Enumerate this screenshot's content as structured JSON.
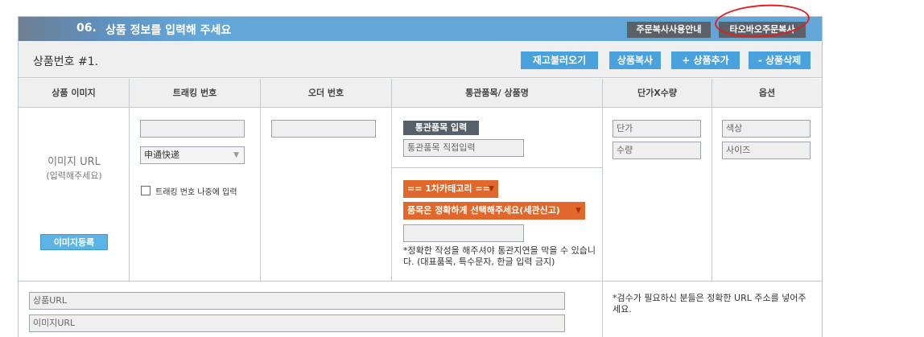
{
  "header": {
    "number": "06.",
    "title": "상품 정보를 입력해 주세요",
    "guide_button": "주문복사사용안내",
    "copy_button": "타오바오주문복사"
  },
  "product": {
    "label": "상품번호 #1.",
    "buttons": {
      "load_stock": "재고불러오기",
      "duplicate": "상품복사",
      "add": "+ 상품추가",
      "delete": "- 상품삭제"
    }
  },
  "columns": [
    "상품 이미지",
    "트래킹 번호",
    "오더 번호",
    "통관품목/ 상품명",
    "단가X수량",
    "옵션"
  ],
  "image": {
    "url_label": "이미지 URL",
    "url_sub": "(입력해주세요)",
    "register_button": "이미지등록"
  },
  "tracking": {
    "input_value": "",
    "carrier_select": "申通快递",
    "later_checkbox_label": "트래킹 번호 나중에 입력"
  },
  "order": {
    "input_value": ""
  },
  "customs": {
    "tag": "통관품목 입력",
    "direct_input_placeholder": "통관품목 직접입력",
    "category_select": "== 1차카테고리 ==",
    "item_select": "품목은 정확하게 선택해주세요(세관신고)",
    "note": "*정확한 작성을 해주셔야 통관지연을 막을 수 있습니다. (대표품목, 특수문자, 한글 입력 금지)"
  },
  "price_qty": {
    "price_placeholder": "단가",
    "qty_placeholder": "수량"
  },
  "options": {
    "color_placeholder": "색상",
    "size_placeholder": "사이즈"
  },
  "urls": {
    "product_url_placeholder": "상품URL",
    "image_url_placeholder": "이미지URL",
    "note": "*검수가 필요하신 분들은 정확한 URL 주소를 넣어주세요."
  },
  "colors": {
    "title_bar": "#63a7d8",
    "blue_button": "#49a2dc",
    "orange_select": "#e0682c",
    "dark_button": "#5b6168"
  }
}
